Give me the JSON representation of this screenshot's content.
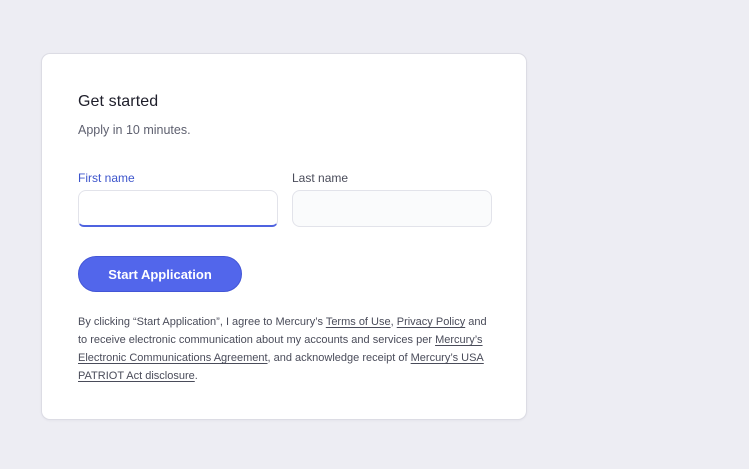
{
  "form": {
    "title": "Get started",
    "subtitle": "Apply in 10 minutes.",
    "first_name": {
      "label": "First name",
      "value": "",
      "placeholder": ""
    },
    "last_name": {
      "label": "Last name",
      "value": "",
      "placeholder": ""
    },
    "submit_label": "Start Application"
  },
  "legal": {
    "part1": "By clicking “Start Application”, I agree to Mercury’s ",
    "terms_link": "Terms of Use",
    "sep1": ", ",
    "privacy_link": "Privacy Policy",
    "part2": " and to receive electronic communication about my accounts and services per ",
    "ecomm_link": "Mercury’s Electronic Communications Agreement",
    "part3": ", and acknowledge receipt of ",
    "patriot_link": "Mercury’s USA PATRIOT Act disclosure",
    "part4": "."
  },
  "colors": {
    "page_background": "#ededf3",
    "accent": "#5266eb",
    "focus_label": "#3d55cc"
  }
}
